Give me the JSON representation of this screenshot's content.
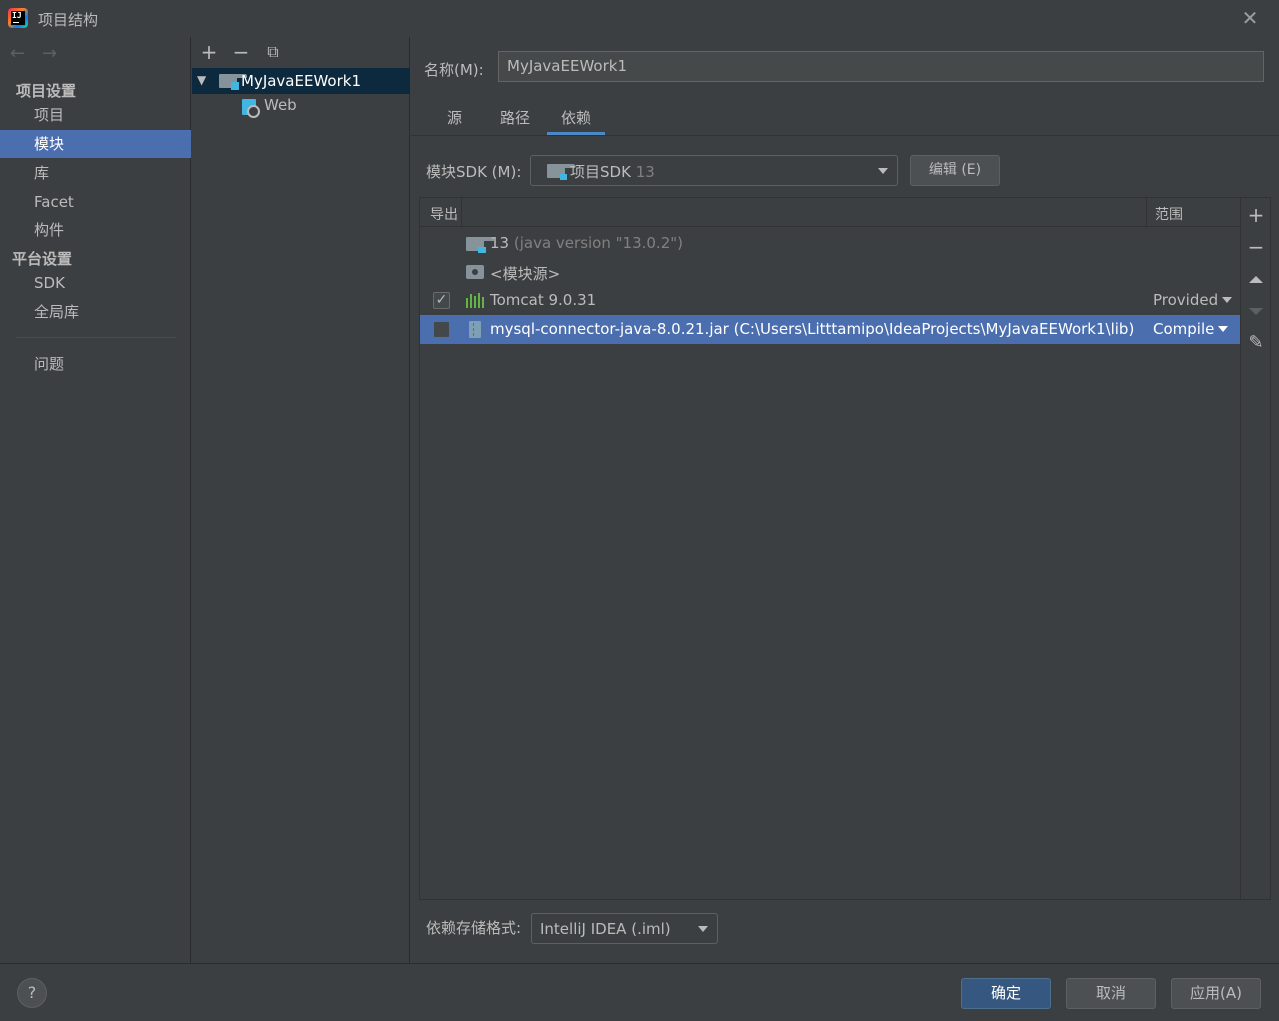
{
  "window": {
    "title": "项目结构",
    "close_glyph": "✕"
  },
  "nav": {
    "back_glyph": "←",
    "forward_glyph": "→",
    "section_project": "项目设置",
    "project_items": [
      "项目",
      "模块",
      "库",
      "Facet",
      "构件"
    ],
    "section_platform": "平台设置",
    "platform_items": [
      "SDK",
      "全局库"
    ],
    "problems": "问题",
    "selected": "模块"
  },
  "tree": {
    "toolbar": {
      "add": "+",
      "remove": "−",
      "copy": "⧉"
    },
    "root": "MyJavaEEWork1",
    "children": [
      "Web"
    ]
  },
  "module": {
    "name_label": "名称(M):",
    "name_value": "MyJavaEEWork1",
    "tabs": [
      "源",
      "路径",
      "依赖"
    ],
    "active_tab": "依赖",
    "sdk_label": "模块SDK (M):",
    "sdk_value": "项目SDK",
    "sdk_version": "13",
    "edit_button": "编辑 (E)",
    "table": {
      "col_export": "导出",
      "col_scope": "范围",
      "rows": [
        {
          "name": "13",
          "detail": "(java version \"13.0.2\")",
          "scope": "",
          "checkbox": false,
          "checked": false
        },
        {
          "name": "<模块源>",
          "detail": "",
          "scope": "",
          "checkbox": false,
          "checked": false
        },
        {
          "name": "Tomcat 9.0.31",
          "detail": "",
          "scope": "Provided",
          "checkbox": true,
          "checked": true
        },
        {
          "name": "mysql-connector-java-8.0.21.jar (C:\\Users\\Litttamipo\\IdeaProjects\\MyJavaEEWork1\\lib)",
          "detail": "",
          "scope": "Compile",
          "checkbox": true,
          "checked": false,
          "selected": true
        }
      ],
      "check_glyph": "✓"
    },
    "side_tools": {
      "add": "+",
      "remove": "−",
      "edit": "✎"
    },
    "storage_label": "依赖存储格式:",
    "storage_value": "IntelliJ IDEA (.iml)"
  },
  "footer": {
    "help": "?",
    "ok": "确定",
    "cancel": "取消",
    "apply": "应用(A)"
  },
  "colors": {
    "background": "#3c3f41",
    "selection": "#4b6eaf",
    "tree_selection": "#0d293e",
    "tab_underline": "#4a88c7",
    "primary_button": "#365880",
    "link": "#589df6"
  }
}
